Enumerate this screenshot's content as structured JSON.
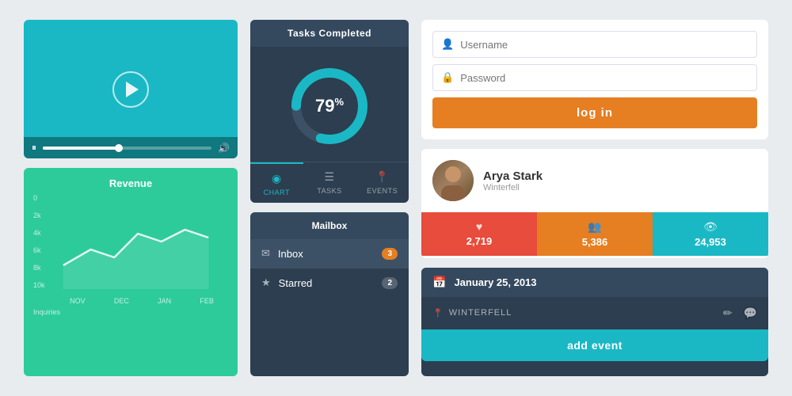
{
  "video": {
    "play_label": "▶",
    "pause_label": "⏸",
    "volume_label": "🔊",
    "progress": 45
  },
  "revenue": {
    "title": "Revenue",
    "y_labels": [
      "10k",
      "8k",
      "6k",
      "4k",
      "2k",
      "0"
    ],
    "x_labels": [
      "NOV",
      "DEC",
      "JAN",
      "FEB"
    ],
    "footer": "Inquiries"
  },
  "tasks": {
    "header": "Tasks Completed",
    "percent": "79",
    "percent_sign": "%",
    "tabs": [
      {
        "label": "CHART",
        "icon": "◉",
        "active": true
      },
      {
        "label": "TASKS",
        "icon": "☰"
      },
      {
        "label": "EVENTS",
        "icon": "📍"
      }
    ]
  },
  "mailbox": {
    "header": "Mailbox",
    "items": [
      {
        "label": "Inbox",
        "icon": "✉",
        "badge": "3",
        "badge_type": "orange"
      },
      {
        "label": "Starred",
        "icon": "★",
        "badge": "2",
        "badge_type": "gray"
      }
    ]
  },
  "login": {
    "username_placeholder": "Username",
    "password_placeholder": "Password",
    "button_label": "log in"
  },
  "profile": {
    "name": "Arya Stark",
    "location": "Winterfell",
    "stats": [
      {
        "icon": "♥",
        "value": "2,719"
      },
      {
        "icon": "👥",
        "value": "5,386"
      },
      {
        "icon": "👁",
        "value": "24,953"
      }
    ]
  },
  "event": {
    "date": "January 25, 2013",
    "location": "WINTERFELL",
    "add_button": "add event"
  }
}
